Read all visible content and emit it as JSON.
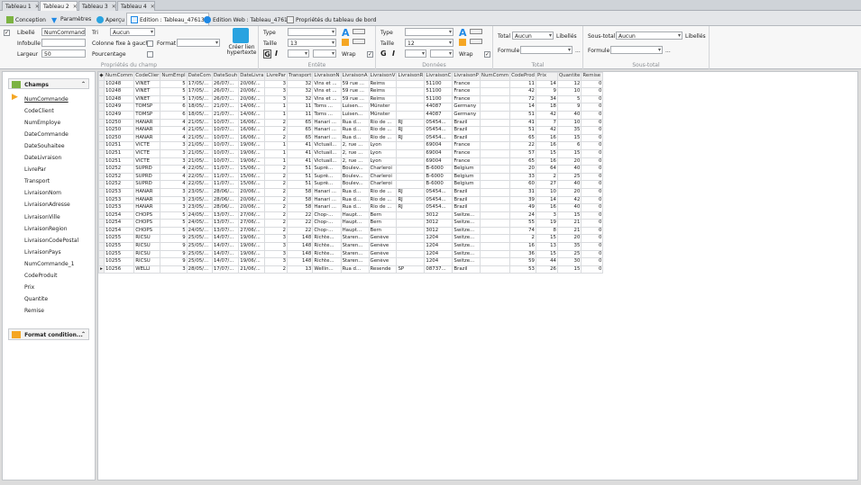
{
  "doc_tabs": [
    {
      "label": "Tableau 1",
      "active": false
    },
    {
      "label": "Tableau 2",
      "active": true
    },
    {
      "label": "Tableau 3",
      "active": false
    },
    {
      "label": "Tableau 4",
      "active": false
    }
  ],
  "ribbon_tabs": [
    {
      "label": "Conception",
      "icon": "design-icon",
      "active": false
    },
    {
      "label": "Paramètres",
      "icon": "filter-icon",
      "active": false
    },
    {
      "label": "Aperçu",
      "icon": "preview-icon",
      "active": false
    },
    {
      "label": "Edition : Tableau_47613",
      "icon": "table-edit-icon",
      "active": true
    },
    {
      "label": "Edition Web : Tableau_47613",
      "icon": "web-icon",
      "active": false
    },
    {
      "label": "Propriétés du tableau de bord",
      "icon": "dashboard-icon",
      "active": false
    }
  ],
  "ribbon": {
    "field_props": {
      "libelle_label": "Libellé",
      "libelle_value": "NumCommande",
      "infobulle_label": "Infobulle",
      "infobulle_value": "",
      "largeur_label": "Largeur",
      "largeur_value": "50",
      "tri_label": "Tri",
      "tri_value": "Aucun",
      "colonne_fixe_label": "Colonne fixe à gauche",
      "format_label": "Format",
      "format_value": "",
      "pourcentage_label": "Pourcentage",
      "hyperlink_label": "Créer lien hypertexte",
      "caption": "Propriétés du champ"
    },
    "header": {
      "type_label": "Type",
      "type_value": "",
      "taille_label": "Taille",
      "taille_value": "13",
      "wrap_label": "Wrap",
      "caption": "Entête"
    },
    "data": {
      "type_label": "Type",
      "type_value": "",
      "taille_label": "Taille",
      "taille_value": "12",
      "wrap_label": "Wrap",
      "caption": "Données"
    },
    "total": {
      "total_label": "Total",
      "total_value": "Aucun",
      "libelles_label": "Libellés",
      "formule_label": "Formule",
      "formule_value": "",
      "ellipsis": "...",
      "caption": "Total"
    },
    "subtotal": {
      "label": "Sous-total",
      "value": "Aucun",
      "libelles_label": "Libellés",
      "formule_label": "Formule",
      "formule_value": "",
      "ellipsis": "...",
      "caption": "Sous-total"
    }
  },
  "left_panel": {
    "champs_label": "Champs",
    "fields": [
      "NumCommande",
      "CodeClient",
      "NumEmploye",
      "DateCommande",
      "DateSouhaitee",
      "DateLivraison",
      "LivrePar",
      "Transport",
      "LivraisonNom",
      "LivraisonAdresse",
      "LivraisonVille",
      "LivraisonRegion",
      "LivraisonCodePostal",
      "LivraisonPays",
      "NumCommande_1",
      "CodeProduit",
      "Prix",
      "Quantite",
      "Remise"
    ],
    "format_label": "Format condition..."
  },
  "grid": {
    "columns": [
      "NumComm",
      "CodeClier",
      "NumEmpl",
      "DateCom",
      "DateSouh",
      "DateLivra",
      "LivrePar",
      "Transport",
      "LivraisonN",
      "LivraisonA",
      "LivraisonV",
      "LivraisonR",
      "LivraisonC",
      "LivraisonP",
      "NumComm",
      "CodeProd",
      "Prix",
      "Quantite",
      "Remise"
    ],
    "rows": [
      [
        "10248",
        "VINET",
        "5",
        "17/05/...",
        "26/07/...",
        "20/06/...",
        "3",
        "32",
        "Vins et ...",
        "59 rue ...",
        "Reims",
        "",
        "51100",
        "France",
        "",
        "11",
        "14",
        "12",
        "0"
      ],
      [
        "10248",
        "VINET",
        "5",
        "17/05/...",
        "26/07/...",
        "20/06/...",
        "3",
        "32",
        "Vins et ...",
        "59 rue ...",
        "Reims",
        "",
        "51100",
        "France",
        "",
        "42",
        "9",
        "10",
        "0"
      ],
      [
        "10248",
        "VINET",
        "5",
        "17/05/...",
        "26/07/...",
        "20/06/...",
        "3",
        "32",
        "Vins et ...",
        "59 rue ...",
        "Reims",
        "",
        "51100",
        "France",
        "",
        "72",
        "34",
        "5",
        "0"
      ],
      [
        "10249",
        "TOMSP",
        "6",
        "18/05/...",
        "21/07/...",
        "14/06/...",
        "1",
        "11",
        "Toms ...",
        "Luisen...",
        "Münster",
        "",
        "44087",
        "Germany",
        "",
        "14",
        "18",
        "9",
        "0"
      ],
      [
        "10249",
        "TOMSP",
        "6",
        "18/05/...",
        "21/07/...",
        "14/06/...",
        "1",
        "11",
        "Toms ...",
        "Luisen...",
        "Münster",
        "",
        "44087",
        "Germany",
        "",
        "51",
        "42",
        "40",
        "0"
      ],
      [
        "10250",
        "HANAR",
        "4",
        "21/05/...",
        "10/07/...",
        "16/06/...",
        "2",
        "65",
        "Hanari ...",
        "Rua d...",
        "Rio de ...",
        "RJ",
        "05454...",
        "Brazil",
        "",
        "41",
        "7",
        "10",
        "0"
      ],
      [
        "10250",
        "HANAR",
        "4",
        "21/05/...",
        "10/07/...",
        "16/06/...",
        "2",
        "65",
        "Hanari ...",
        "Rua d...",
        "Rio de ...",
        "RJ",
        "05454...",
        "Brazil",
        "",
        "51",
        "42",
        "35",
        "0"
      ],
      [
        "10250",
        "HANAR",
        "4",
        "21/05/...",
        "10/07/...",
        "16/06/...",
        "2",
        "65",
        "Hanari ...",
        "Rua d...",
        "Rio de ...",
        "RJ",
        "05454...",
        "Brazil",
        "",
        "65",
        "16",
        "15",
        "0"
      ],
      [
        "10251",
        "VICTE",
        "3",
        "21/05/...",
        "10/07/...",
        "19/06/...",
        "1",
        "41",
        "Victuail...",
        "2, rue ...",
        "Lyon",
        "",
        "69004",
        "France",
        "",
        "22",
        "16",
        "6",
        "0"
      ],
      [
        "10251",
        "VICTE",
        "3",
        "21/05/...",
        "10/07/...",
        "19/06/...",
        "1",
        "41",
        "Victuail...",
        "2, rue ...",
        "Lyon",
        "",
        "69004",
        "France",
        "",
        "57",
        "15",
        "15",
        "0"
      ],
      [
        "10251",
        "VICTE",
        "3",
        "21/05/...",
        "10/07/...",
        "19/06/...",
        "1",
        "41",
        "Victuail...",
        "2, rue ...",
        "Lyon",
        "",
        "69004",
        "France",
        "",
        "65",
        "16",
        "20",
        "0"
      ],
      [
        "10252",
        "SUPRD",
        "4",
        "22/05/...",
        "11/07/...",
        "15/06/...",
        "2",
        "51",
        "Suprê...",
        "Boulev...",
        "Charleroi",
        "",
        "B-6000",
        "Belgium",
        "",
        "20",
        "64",
        "40",
        "0"
      ],
      [
        "10252",
        "SUPRD",
        "4",
        "22/05/...",
        "11/07/...",
        "15/06/...",
        "2",
        "51",
        "Suprê...",
        "Boulev...",
        "Charleroi",
        "",
        "B-6000",
        "Belgium",
        "",
        "33",
        "2",
        "25",
        "0"
      ],
      [
        "10252",
        "SUPRD",
        "4",
        "22/05/...",
        "11/07/...",
        "15/06/...",
        "2",
        "51",
        "Suprê...",
        "Boulev...",
        "Charleroi",
        "",
        "B-6000",
        "Belgium",
        "",
        "60",
        "27",
        "40",
        "0"
      ],
      [
        "10253",
        "HANAR",
        "3",
        "23/05/...",
        "28/06/...",
        "20/06/...",
        "2",
        "58",
        "Hanari ...",
        "Rua d...",
        "Rio de ...",
        "RJ",
        "05454...",
        "Brazil",
        "",
        "31",
        "10",
        "20",
        "0"
      ],
      [
        "10253",
        "HANAR",
        "3",
        "23/05/...",
        "28/06/...",
        "20/06/...",
        "2",
        "58",
        "Hanari ...",
        "Rua d...",
        "Rio de ...",
        "RJ",
        "05454...",
        "Brazil",
        "",
        "39",
        "14",
        "42",
        "0"
      ],
      [
        "10253",
        "HANAR",
        "3",
        "23/05/...",
        "28/06/...",
        "20/06/...",
        "2",
        "58",
        "Hanari ...",
        "Rua d...",
        "Rio de ...",
        "RJ",
        "05454...",
        "Brazil",
        "",
        "49",
        "16",
        "40",
        "0"
      ],
      [
        "10254",
        "CHOPS",
        "5",
        "24/05/...",
        "13/07/...",
        "27/06/...",
        "2",
        "22",
        "Chop-...",
        "Haupt...",
        "Bern",
        "",
        "3012",
        "Switze...",
        "",
        "24",
        "3",
        "15",
        "0"
      ],
      [
        "10254",
        "CHOPS",
        "5",
        "24/05/...",
        "13/07/...",
        "27/06/...",
        "2",
        "22",
        "Chop-...",
        "Haupt...",
        "Bern",
        "",
        "3012",
        "Switze...",
        "",
        "55",
        "19",
        "21",
        "0"
      ],
      [
        "10254",
        "CHOPS",
        "5",
        "24/05/...",
        "13/07/...",
        "27/06/...",
        "2",
        "22",
        "Chop-...",
        "Haupt...",
        "Bern",
        "",
        "3012",
        "Switze...",
        "",
        "74",
        "8",
        "21",
        "0"
      ],
      [
        "10255",
        "RICSU",
        "9",
        "25/05/...",
        "14/07/...",
        "19/06/...",
        "3",
        "148",
        "Richte...",
        "Staren...",
        "Genève",
        "",
        "1204",
        "Switze...",
        "",
        "2",
        "15",
        "20",
        "0"
      ],
      [
        "10255",
        "RICSU",
        "9",
        "25/05/...",
        "14/07/...",
        "19/06/...",
        "3",
        "148",
        "Richte...",
        "Staren...",
        "Genève",
        "",
        "1204",
        "Switze...",
        "",
        "16",
        "13",
        "35",
        "0"
      ],
      [
        "10255",
        "RICSU",
        "9",
        "25/05/...",
        "14/07/...",
        "19/06/...",
        "3",
        "148",
        "Richte...",
        "Staren...",
        "Genève",
        "",
        "1204",
        "Switze...",
        "",
        "36",
        "15",
        "25",
        "0"
      ],
      [
        "10255",
        "RICSU",
        "9",
        "25/05/...",
        "14/07/...",
        "19/06/...",
        "3",
        "148",
        "Richte...",
        "Staren...",
        "Genève",
        "",
        "1204",
        "Switze...",
        "",
        "59",
        "44",
        "30",
        "0"
      ],
      [
        "10256",
        "WELLI",
        "3",
        "28/05/...",
        "17/07/...",
        "21/06/...",
        "2",
        "13",
        "Wellin...",
        "Rua d...",
        "Resende",
        "SP",
        "08737...",
        "Brazil",
        "",
        "53",
        "26",
        "15",
        "0"
      ]
    ]
  }
}
